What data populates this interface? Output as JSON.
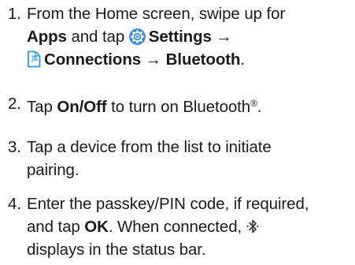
{
  "steps": [
    {
      "number": "1.",
      "line1": "From the Home screen, swipe up for",
      "apps": "Apps",
      "and_tap": " and tap ",
      "settings": "Settings",
      "arrow1": " →",
      "connections": "Connections",
      "arrow2": " → ",
      "bluetooth": "Bluetooth",
      "period": "."
    },
    {
      "number": "2.",
      "tap": "Tap ",
      "on_off": "On/Off",
      "rest": " to turn on Bluetooth",
      "reg": "®",
      "period": "."
    },
    {
      "number": "3.",
      "line1": "Tap a device from the list to initiate",
      "line2": "pairing."
    },
    {
      "number": "4.",
      "line1": "Enter the passkey/PIN code, if required,",
      "and_tap": "and tap ",
      "ok": "OK",
      "connected": ". When connected, ",
      "line3": "displays in the status bar."
    }
  ],
  "colors": {
    "text": "#1a1a1a",
    "settings_icon_bg": "#3a8ee6",
    "connections_icon": "#2f9be0"
  },
  "icons": {
    "settings": "settings-gear-icon",
    "connections": "connections-document-icon",
    "bluetooth": "bluetooth-connected-icon"
  }
}
